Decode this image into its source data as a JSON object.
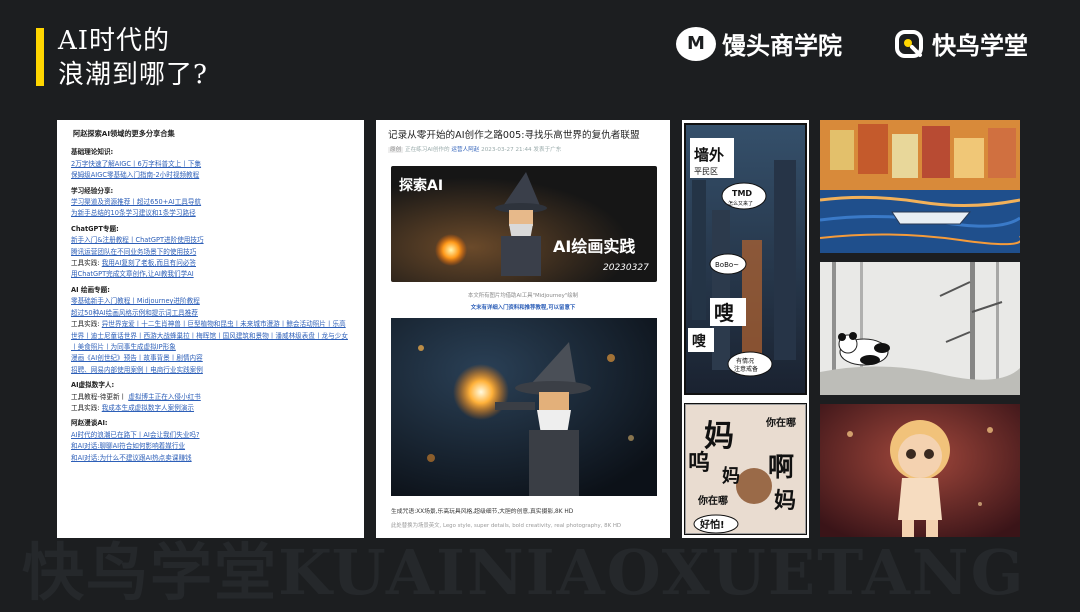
{
  "header": {
    "title_line1": "AI时代的",
    "title_line2": "浪潮到哪了?",
    "brand1": "馒头商学院",
    "brand1_logo": "M",
    "brand2": "快鸟学堂"
  },
  "watermark": "快鸟学堂KUAINIAOXUETANG",
  "link_panel": {
    "title": "阿赵探索AI领域的更多分享合集",
    "sections": [
      {
        "heading": "基础理论知识:",
        "lines": [
          "2万字快速了解AIGC丨6万字科普文上丨下集",
          "保姆级AIGC零基础入门指南-2小时视频教程"
        ]
      },
      {
        "heading": "学习经验分享:",
        "lines": [
          "学习渠道及资源推荐丨超过650+AI工具导航",
          "为新手总结的10条学习建议和1条学习路径"
        ]
      },
      {
        "heading": "ChatGPT专题:",
        "lines": [
          "新手入门&注册教程丨ChatGPT进阶使用技巧",
          "腾讯运营团队在不同业务场景下的使用技巧"
        ],
        "mixed": {
          "prefix": "工具实践:",
          "link": "我用AI复刻了老板,而且有问必答"
        },
        "tail": "用ChatGPT完成文章创作,让AI教我们学AI"
      },
      {
        "heading": "AI 绘画专题:",
        "lines": [
          "零基础新手入门教程丨Midjourney进阶教程",
          "超过50种AI绘画风格示例和提示词工具推荐"
        ],
        "practice_prefix": "工具实践:",
        "practice_links": "异世界宠爱丨十二生肖神兽丨巨型植物和昆虫丨未来城市漫游丨鲸会活动照片丨乐高世界丨迪士尼童话世界丨西游大战蜂巢拉丨梅晖馆丨国风建筑和景物丨潘威林级表盘丨龙与少女丨美食照片丨为同事生成虚拟IP形象",
        "extra_lines": [
          "漫画《AI创世纪》预告丨故事背景丨剧情内容",
          "招聘、网易内部使用案例丨电商行业实践案例"
        ]
      },
      {
        "heading": "AI虚拟数字人:",
        "link_rows": [
          {
            "prefix": "工具教程-待更新丨",
            "link": "虚拟博主正在入侵小红书"
          },
          {
            "prefix": "工具实践:",
            "link": "我成本生成虚拟数字人案例演示"
          }
        ]
      },
      {
        "heading": "阿赵漫谈AI:",
        "lines": [
          "AI时代的浪潮已在路下丨AI会让我们失业吗?",
          "和AI对话:聊聊AI符合如何影响着媒行业",
          "和AI对话:为什么不建议跟AI热点卖课赚钱"
        ]
      }
    ]
  },
  "article": {
    "title": "记录从零开始的AI创作之路005:寻找乐高世界的复仇者联盟",
    "meta_tag": "原创",
    "meta_author": "正在练习AI创作的",
    "meta_account": "运营人阿赵",
    "meta_date": "2023-03-27 21:44",
    "meta_tail": "发表于广东",
    "cover_top": "探索AI",
    "cover_main": "AI绘画实践",
    "cover_date": "20230327",
    "caption1": "本文所有图片均借助AI工具\"Midjourney\"绘制",
    "caption2": "文末有详细入门资料和推荐教程,可以留意下",
    "prompt1": "生成咒语:XX场景,乐高玩具风格,超级细节,大胆的创意,真实摄影,8K HD",
    "prompt2": "此处替换为场景英文, Lego style, super details, bold creativity, real photography, 8K HD"
  },
  "comic": {
    "header_text": "墙外",
    "header_sub": "平民区",
    "bubble1_a": "TMD",
    "bubble1_b": "怎么又来了",
    "bubble2": "BoBo~",
    "sfx1": "嗖",
    "sfx2": "嗖",
    "bubble3_a": "有情况",
    "bubble3_b": "注意戒备",
    "bubble4": "你在哪",
    "big1": "妈",
    "big2": "妈",
    "big3": "啊",
    "big4": "妈",
    "bubble5": "你在哪",
    "bubble6": "好怕!",
    "left_char": "呜"
  },
  "colors": {
    "accent": "#ffd600",
    "background": "#1c1e20",
    "link": "#2d5fb8"
  }
}
